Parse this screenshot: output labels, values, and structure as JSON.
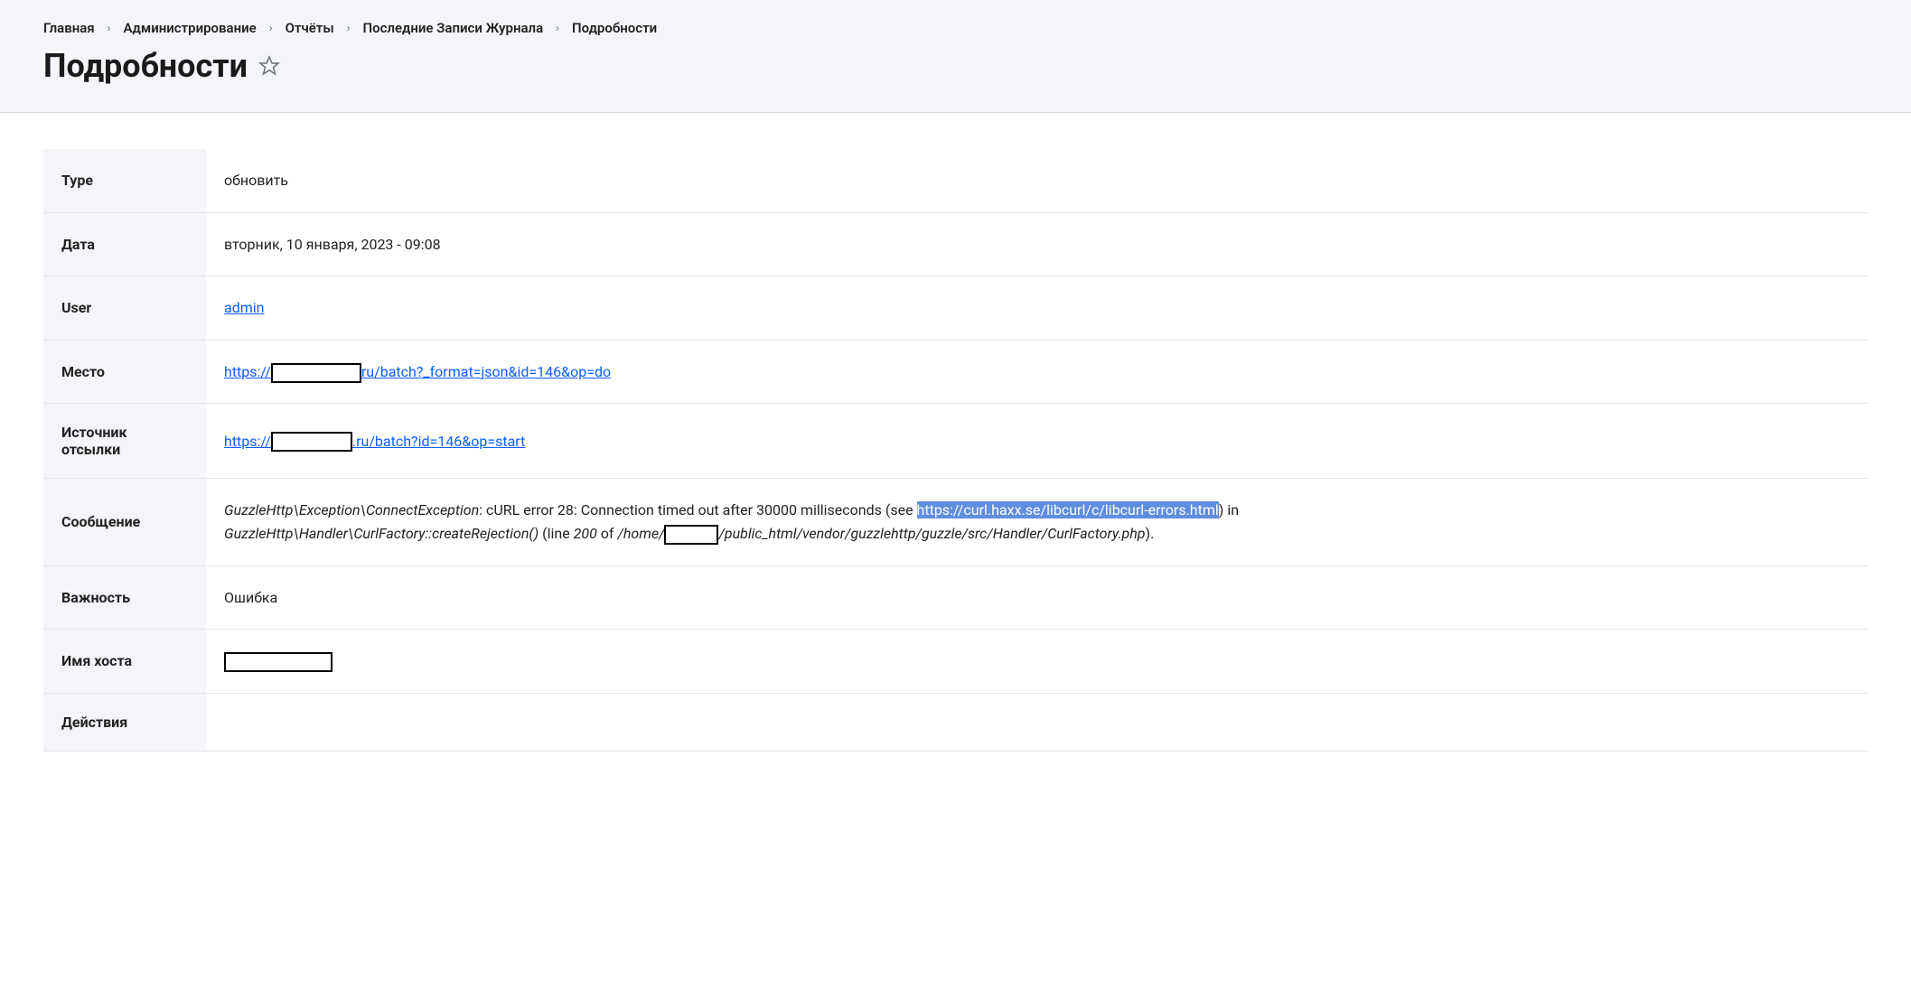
{
  "breadcrumb": {
    "items": [
      "Главная",
      "Администрирование",
      "Отчёты",
      "Последние Записи Журнала"
    ],
    "current": "Подробности"
  },
  "page_title": "Подробности",
  "rows": {
    "type": {
      "label": "Type",
      "value": "обновить"
    },
    "date": {
      "label": "Дата",
      "value": "вторник, 10 января, 2023 - 09:08"
    },
    "user": {
      "label": "User",
      "value": "admin"
    },
    "location": {
      "label": "Место",
      "url_prefix": "https://",
      "url_suffix": "ru/batch?_format=json&id=146&op=do"
    },
    "referer": {
      "label": "Источник отсылки",
      "url_prefix": "https://",
      "url_suffix": ".ru/batch?id=146&op=start"
    },
    "message": {
      "label": "Сообщение",
      "exception": "GuzzleHttp\\Exception\\ConnectException",
      "text1": ": cURL error 28: Connection timed out after 30000 milliseconds (see ",
      "highlighted_url": "https://curl.haxx.se/libcurl/c/libcurl-errors.html",
      "text2": ") in ",
      "method": "GuzzleHttp\\Handler\\CurlFactory::createRejection()",
      "line_open": " (line ",
      "line_no": "200",
      "of_text": " of ",
      "path_prefix": "/home/",
      "path_suffix": "/public_html/vendor/guzzlehttp/guzzle/src/Handler/CurlFactory.php",
      "end": ")."
    },
    "severity": {
      "label": "Важность",
      "value": "Ошибка"
    },
    "hostname": {
      "label": "Имя хоста"
    },
    "actions": {
      "label": "Действия",
      "value": ""
    }
  }
}
